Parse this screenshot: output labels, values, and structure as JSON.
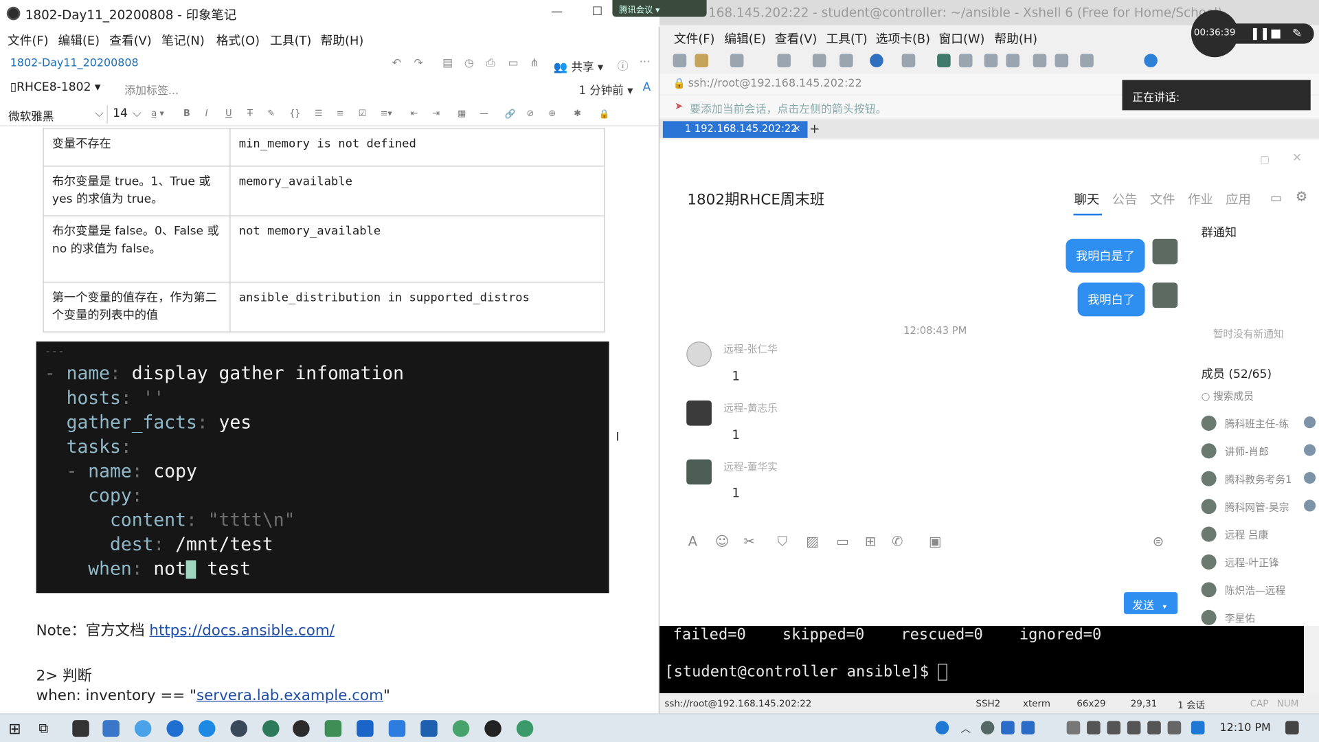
{
  "evernote": {
    "window_title": "1802-Day11_20200808 - 印象笔记",
    "menu": [
      "文件(F)",
      "编辑(E)",
      "查看(V)",
      "笔记(N)",
      "格式(O)",
      "工具(T)",
      "帮助(H)"
    ],
    "note_title": "1802-Day11_20200808",
    "share_label": "共享",
    "notebook": "RHCE8-1802",
    "add_tag": "添加标签...",
    "modified": "1 分钟前",
    "font_family": "微软雅黑",
    "font_size": "14",
    "table": [
      {
        "cond": "变量不存在",
        "example": "min_memory is not defined"
      },
      {
        "cond": "布尔变量是 true。1、True 或 yes 的求值为 true。",
        "example": "memory_available"
      },
      {
        "cond": "布尔变量是 false。0、False 或 no 的求值为 false。",
        "example": "not memory_available"
      },
      {
        "cond": "第一个变量的值存在，作为第二个变量的列表中的值",
        "example": "ansible_distribution in supported_distros"
      }
    ],
    "code": {
      "separator": "---",
      "lines": [
        {
          "indent": "- ",
          "key": "name",
          "val": "display gather infomation"
        },
        {
          "indent": "  ",
          "key": "hosts",
          "val": "''"
        },
        {
          "indent": "  ",
          "key": "gather_facts",
          "val": "yes"
        },
        {
          "indent": "  ",
          "key": "tasks",
          "val": ""
        },
        {
          "indent": "  - ",
          "key": "name",
          "val": "copy"
        },
        {
          "indent": "    ",
          "key": "copy",
          "val": ""
        },
        {
          "indent": "      ",
          "key": "content",
          "val": "\"tttt\\n\""
        },
        {
          "indent": "      ",
          "key": "dest",
          "val": "/mnt/test"
        },
        {
          "indent": "    ",
          "key": "when",
          "val_before": "not",
          "val_after": "test"
        }
      ]
    },
    "note_label": "Note：官方文档",
    "note_link": "https://docs.ansible.com/",
    "section": "2> 判断",
    "when_prefix": "when: inventory == \"",
    "when_link": "servera.lab.example.com",
    "when_suffix": "\""
  },
  "xshell": {
    "window_title": "168.145.202:22 - student@controller: ~/ansible - Xshell 6 (Free for Home/School)",
    "tencent_label": "腾讯会议",
    "menu": [
      "文件(F)",
      "编辑(E)",
      "查看(V)",
      "工具(T)",
      "选项卡(B)",
      "窗口(W)",
      "帮助(H)"
    ],
    "address": "ssh://root@192.168.145.202:22",
    "hint": "要添加当前会话，点击左侧的箭头按钮。",
    "tab_label": "1 192.168.145.202:22",
    "terminal_line1": "failed=0    skipped=0    rescued=0    ignored=0",
    "terminal_prompt": "[student@controller ansible]$ ",
    "status": {
      "conn": "ssh://root@192.168.145.202:22",
      "proto": "SSH2",
      "term": "xterm",
      "size": "66x29",
      "pos": "29,31",
      "sessions": "1 会话",
      "cap": "CAP",
      "num": "NUM"
    }
  },
  "meeting": {
    "timer": "00:36:39",
    "speaking": "正在讲话:"
  },
  "chat": {
    "group_name": "1802期RHCE周末班",
    "tabs": [
      "聊天",
      "公告",
      "文件",
      "作业",
      "应用"
    ],
    "my_messages": [
      "我明白是了",
      "我明白了"
    ],
    "time": "12:08:43 PM",
    "messages": [
      {
        "name": "远程-张仁华",
        "text": "1"
      },
      {
        "name": "远程-黄志乐",
        "text": "1"
      },
      {
        "name": "远程-董华实",
        "text": "1"
      }
    ],
    "notice_title": "群通知",
    "notice_empty": "暂时没有新通知",
    "members_title": "成员 (52/65)",
    "search_members": "搜索成员",
    "members": [
      "腾科班主任-练",
      "讲师-肖郎",
      "腾科教务考务1",
      "腾科网管-吴宗",
      "远程 吕康",
      "远程-叶正锋",
      "陈炽浩—远程",
      "李星佑"
    ],
    "send_label": "发送"
  },
  "taskbar": {
    "clock": "12:10 PM"
  },
  "colors": {
    "accent_blue": "#2f8ff0",
    "code_bg": "#161616",
    "link": "#1f4fa8"
  }
}
